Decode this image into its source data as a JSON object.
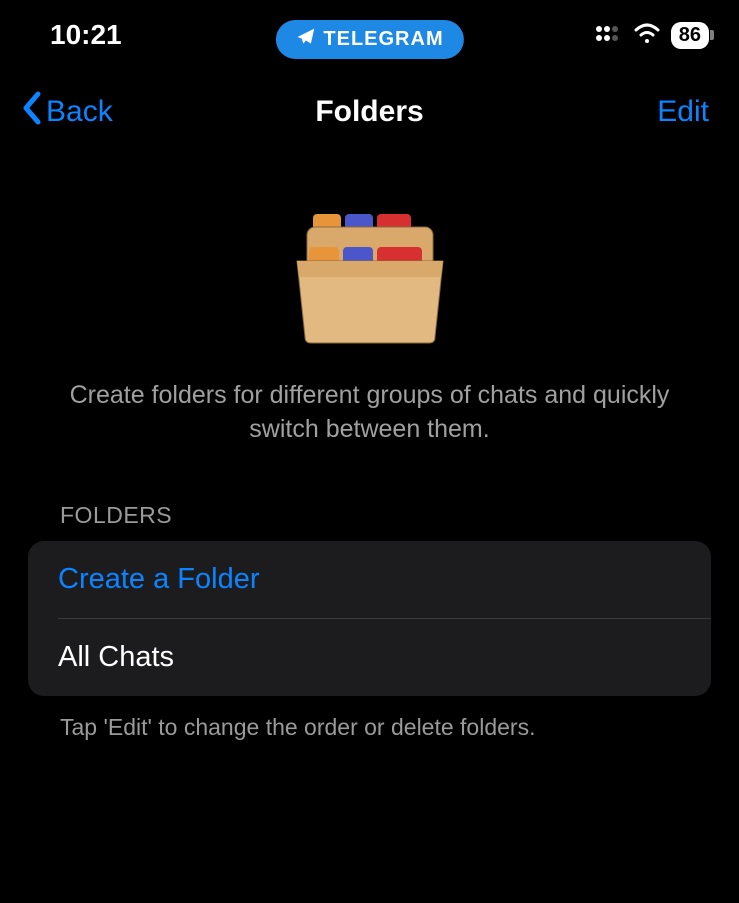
{
  "status": {
    "time": "10:21",
    "app_label": "TELEGRAM",
    "battery": "86"
  },
  "nav": {
    "back_label": "Back",
    "title": "Folders",
    "edit_label": "Edit"
  },
  "description": "Create folders for different groups of chats and quickly switch between them.",
  "section": {
    "header": "FOLDERS",
    "create_label": "Create a Folder",
    "all_chats_label": "All Chats",
    "footer": "Tap 'Edit' to change the order or delete folders."
  }
}
